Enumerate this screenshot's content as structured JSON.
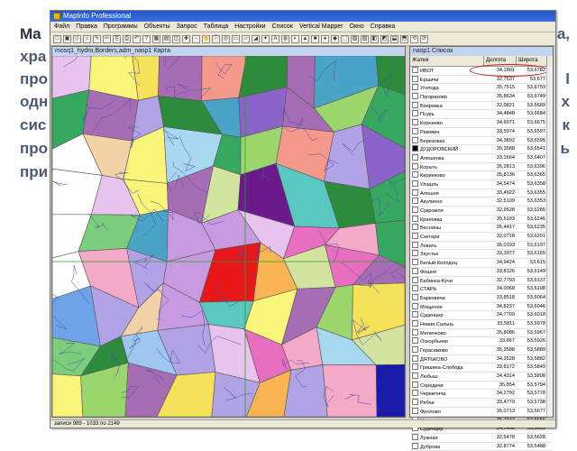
{
  "background": {
    "heading": "Ma",
    "left_fragments": [
      "хра",
      "про",
      "одн",
      "сис",
      "про",
      "при"
    ],
    "right_fragments": [
      "а,",
      "l",
      "х",
      "к",
      "ь"
    ]
  },
  "app": {
    "title": "MapInfo Professional",
    "menu": [
      "Файл",
      "Правка",
      "Программы",
      "Объекты",
      "Запрос",
      "Таблица",
      "Настройки",
      "Список",
      "Vertical Mapper",
      "Окно",
      "Справка"
    ],
    "map_title": "mosq1_hydro,Borders,adm_nasp1 Карта",
    "list_title": "nasp1 Список",
    "columns": [
      "Жатея",
      "Долгота",
      "Широта"
    ],
    "rows": [
      [
        "ИВОТ",
        "34,1801",
        "53,6782"
      ],
      [
        "Ершичи",
        "32,7537",
        "53,677"
      ],
      [
        "Угопода",
        "35,7515",
        "53,6759"
      ],
      [
        "Погариково",
        "35,8634",
        "53,6749"
      ],
      [
        "Бояревка",
        "32,9821",
        "53,6689"
      ],
      [
        "Псурь",
        "34,4848",
        "53,6684"
      ],
      [
        "Корнеево",
        "34,6071",
        "53,6675"
      ],
      [
        "Ракович",
        "33,5974",
        "53,6597"
      ],
      [
        "Березовка",
        "34,3892",
        "53,6595"
      ],
      [
        "ДУДОРОВСКИЙ",
        "35,3588",
        "53,6541"
      ],
      [
        "Алешенка",
        "33,1664",
        "53,6407"
      ],
      [
        "Корыть",
        "35,2813",
        "53,6396"
      ],
      [
        "Кириеково",
        "35,8136",
        "53,6365"
      ],
      [
        "Улашль",
        "34,5474",
        "53,6358"
      ],
      [
        "Алешня",
        "33,4922",
        "53,6355"
      ],
      [
        "Акулинно",
        "32,5109",
        "53,6353"
      ],
      [
        "Сукромля",
        "32,9528",
        "53,6286"
      ],
      [
        "Краповка",
        "35,5193",
        "53,6246"
      ],
      [
        "Веснины",
        "35,4417",
        "53,6235"
      ],
      [
        "Сектари",
        "32,0718",
        "53,6201"
      ],
      [
        "Ловать",
        "35,0193",
        "53,6197"
      ],
      [
        "Заустье",
        "33,3977",
        "53,6155"
      ],
      [
        "Белый-Колодец",
        "34,9424",
        "53,615"
      ],
      [
        "Фошня",
        "33,8126",
        "53,6149"
      ],
      [
        "Бабинка-Кучи",
        "32,7793",
        "53,6137"
      ],
      [
        "СТАРЬ",
        "34,0068",
        "53,6108"
      ],
      [
        "Барковичи",
        "33,8518",
        "53,6064"
      ],
      [
        "Мощеное",
        "34,8237",
        "53,6046"
      ],
      [
        "Суденцер",
        "34,7709",
        "53,6018"
      ],
      [
        "Новая Сальнь",
        "33,5811",
        "53,5978"
      ],
      [
        "Меленково",
        "35,8086",
        "53,5967"
      ],
      [
        "Оскорбьево",
        "33,867",
        "53,5926"
      ],
      [
        "Герасимово",
        "35,3588",
        "53,5889"
      ],
      [
        "ДЯТЬКОВО",
        "34,3528",
        "53,5882"
      ],
      [
        "Гришина-Слобода",
        "33,8172",
        "53,5849"
      ],
      [
        "Любыш",
        "34,4314",
        "53,5808"
      ],
      [
        "Середичи",
        "35,854",
        "53,5794"
      ],
      [
        "Черметичи",
        "34,2792",
        "53,5778"
      ],
      [
        "Рябчи",
        "33,4779",
        "53,5738"
      ],
      [
        "Фролово",
        "35,0713",
        "53,5677"
      ],
      [
        "Новая",
        "35,7347",
        "53,5656"
      ],
      [
        "Суденцер",
        "34,7408",
        "53,5633"
      ],
      [
        "Лужная",
        "32,5478",
        "53,5628"
      ],
      [
        "Дуброва",
        "32,8774",
        "53,5488"
      ]
    ],
    "status": "записи 989 - 1033 по 2149"
  }
}
